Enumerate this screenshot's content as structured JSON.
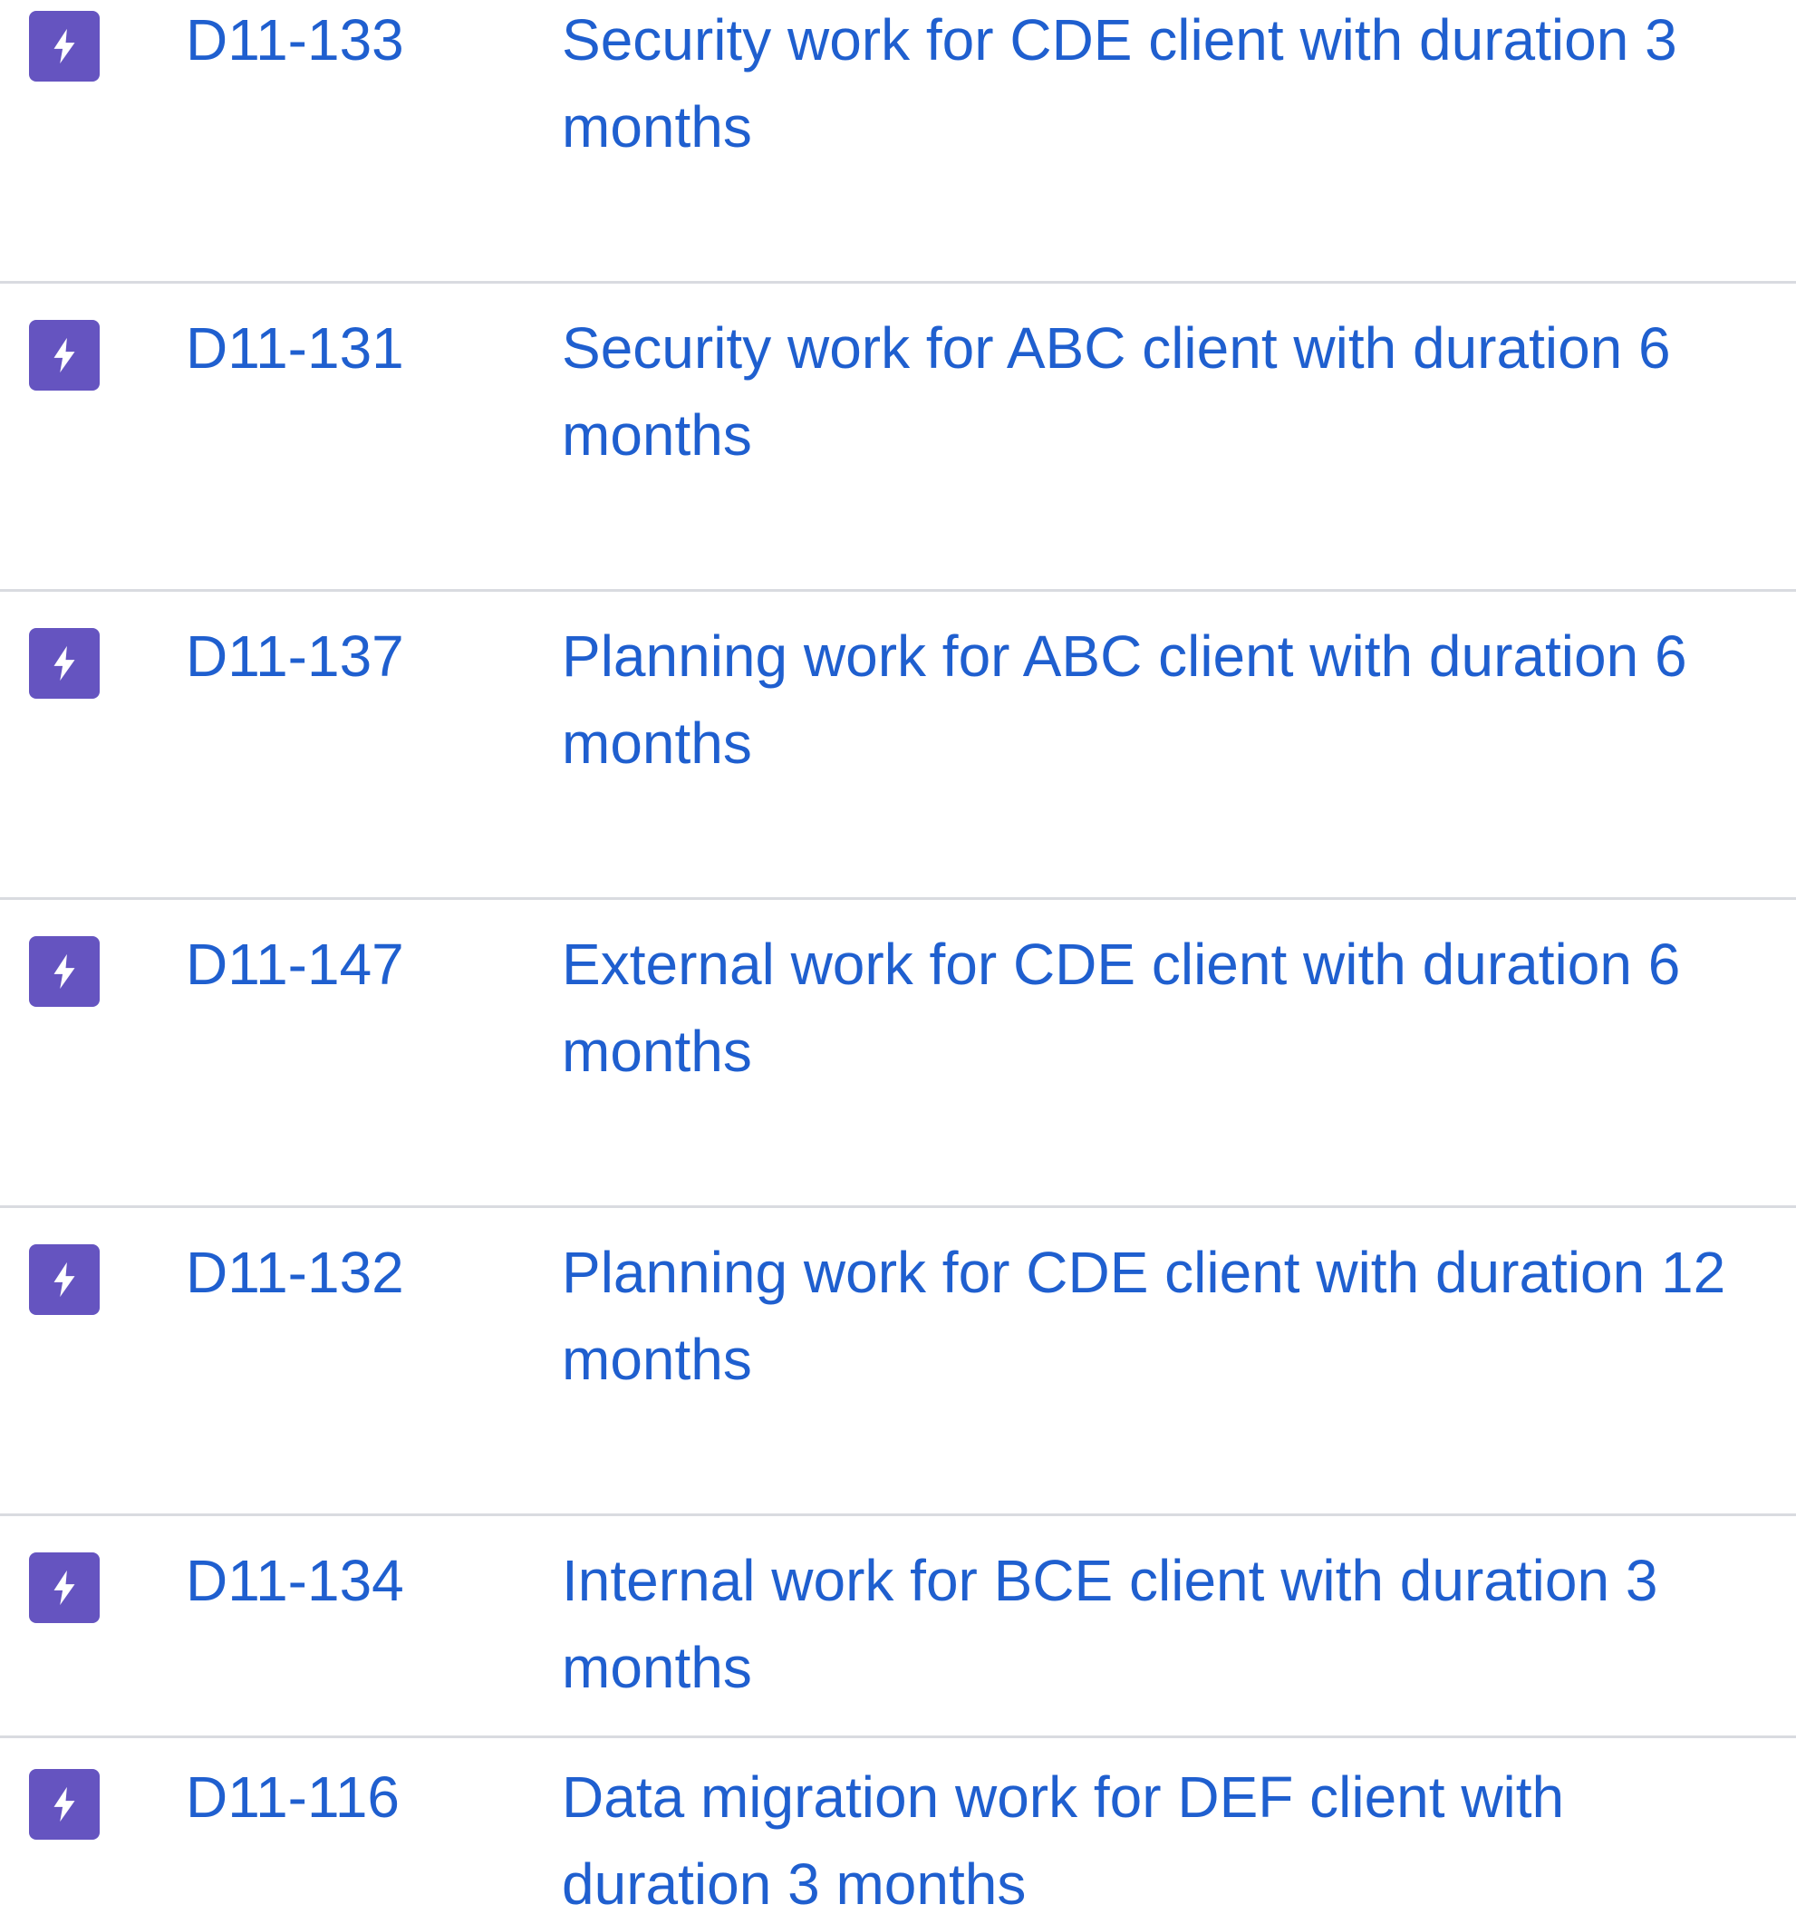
{
  "issues": [
    {
      "icon": "lightning-bolt-icon",
      "key": "D11-133",
      "summary": "Security work for CDE client with duration 3 months"
    },
    {
      "icon": "lightning-bolt-icon",
      "key": "D11-131",
      "summary": "Security work for ABC client with duration 6 months"
    },
    {
      "icon": "lightning-bolt-icon",
      "key": "D11-137",
      "summary": "Planning work for ABC client with duration 6 months"
    },
    {
      "icon": "lightning-bolt-icon",
      "key": "D11-147",
      "summary": "External work for CDE client with duration 6 months"
    },
    {
      "icon": "lightning-bolt-icon",
      "key": "D11-132",
      "summary": "Planning work for CDE client with duration 12 months"
    },
    {
      "icon": "lightning-bolt-icon",
      "key": "D11-134",
      "summary": "Internal work for BCE client with duration 3 months"
    },
    {
      "icon": "lightning-bolt-icon",
      "key": "D11-116",
      "summary": "Data migration work for DEF client with duration 3 months"
    }
  ],
  "colors": {
    "link": "#1f5fcf",
    "icon_background": "#6554c0",
    "divider": "#d9dbe0"
  }
}
